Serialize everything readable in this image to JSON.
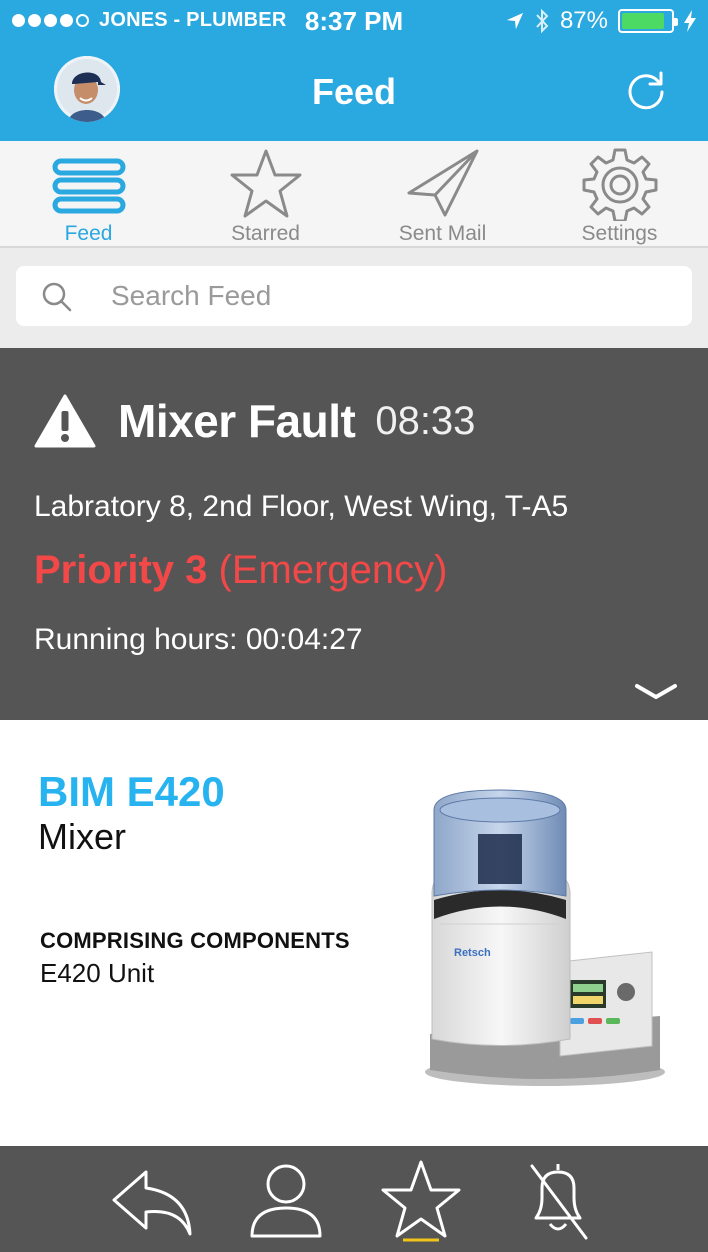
{
  "status_bar": {
    "carrier": "JONES - PLUMBER",
    "time": "8:37 PM",
    "battery": "87%",
    "battery_level": 0.87,
    "icons": [
      "signal-dots-icon",
      "location-arrow-icon",
      "bluetooth-icon",
      "battery-icon",
      "charging-bolt-icon"
    ]
  },
  "header": {
    "title": "Feed",
    "avatar_icon": "user-avatar",
    "refresh_icon": "refresh-icon"
  },
  "tabs": [
    {
      "label": "Feed",
      "icon": "feed-list-icon",
      "active": true
    },
    {
      "label": "Starred",
      "icon": "star-icon",
      "active": false
    },
    {
      "label": "Sent Mail",
      "icon": "paper-plane-icon",
      "active": false
    },
    {
      "label": "Settings",
      "icon": "gear-icon",
      "active": false
    }
  ],
  "search": {
    "placeholder": "Search Feed",
    "value": ""
  },
  "alert": {
    "title": "Mixer Fault",
    "time": "08:33",
    "location": "Labratory 8, 2nd Floor, West Wing, T-A5",
    "priority_level": "Priority 3",
    "priority_label": "(Emergency)",
    "running_label": "Running hours:",
    "running_value": "00:04:27",
    "priority_color": "#f24848"
  },
  "product": {
    "model": "BIM E420",
    "type": "Mixer",
    "components_heading": "COMPRISING COMPONENTS",
    "components": "E420 Unit",
    "image": "mixer-machine-image",
    "image_brand_text": "Retsch"
  },
  "bottom_bar": {
    "buttons": [
      "reply-icon",
      "contact-person-icon",
      "star-icon",
      "bell-muted-icon"
    ]
  },
  "colors": {
    "brand_blue": "#2aa8e0",
    "model_blue": "#27b3ef",
    "panel_gray": "#555555"
  }
}
